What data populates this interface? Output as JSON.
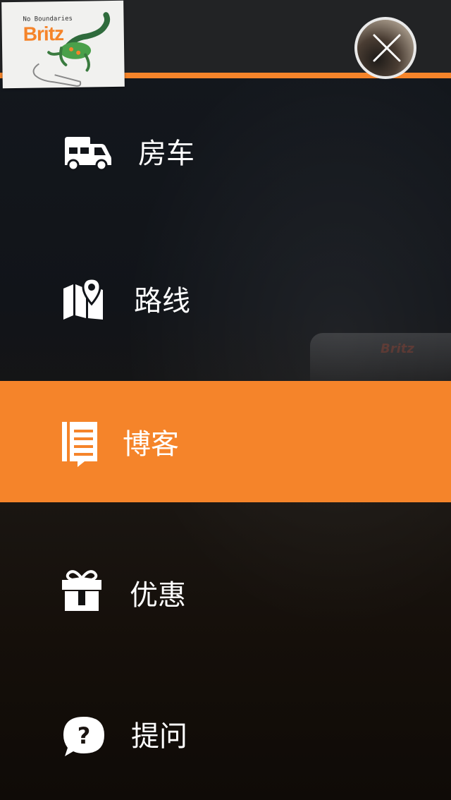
{
  "logo": {
    "tagline": "No Boundaries",
    "name": "Britz"
  },
  "close_button": {
    "icon": "close-icon"
  },
  "menu": {
    "items": [
      {
        "label": "房车",
        "icon": "campervan-icon",
        "active": false
      },
      {
        "label": "路线",
        "icon": "map-pin-icon",
        "active": false
      },
      {
        "label": "博客",
        "icon": "blog-icon",
        "active": true
      },
      {
        "label": "优惠",
        "icon": "gift-icon",
        "active": false
      },
      {
        "label": "提问",
        "icon": "question-bubble-icon",
        "active": false
      }
    ]
  },
  "background": {
    "van_brand": "Britz"
  },
  "colors": {
    "accent": "#f5842a",
    "topbar": "#222325",
    "text": "#ffffff"
  }
}
